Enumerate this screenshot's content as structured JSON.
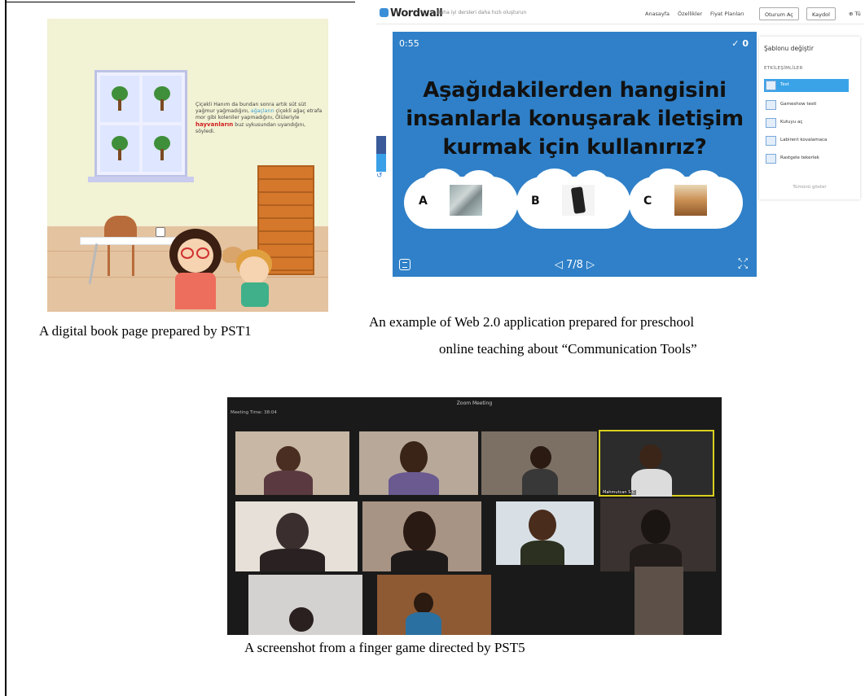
{
  "book": {
    "story_text": "Çiçekli Hanım da bundan sonra artık süt süt yağmur yağmadığını, ağaçların çiçekli ağaç etrafa mor gibi koleniler yapmadığını, Ölüleriyle hayvanların buz uykusundan uyandığını, söyledi.",
    "highlight_1": "ağaçların",
    "highlight_2": "hayvanların"
  },
  "captions": {
    "book": "A digital book page prepared by PST1",
    "wordwall_line1": "An example of Web 2.0 application prepared for preschool",
    "wordwall_line2": "online teaching about “Communication Tools”",
    "zoom": "A screenshot from a finger game directed by PST5"
  },
  "wordwall": {
    "logo": "Wordwall",
    "tagline": "Daha iyi dersleri daha hızlı oluşturun",
    "nav": [
      "Anasayfa",
      "Özellikler",
      "Fiyat Planları"
    ],
    "login": "Oturum Aç",
    "signup": "Kaydol",
    "lang": "Tü",
    "timer": "0:55",
    "score": "✓ 0",
    "question_line1": "Aşağıdakilerden hangisini",
    "question_line2": "insanlarla konuşarak iletişim",
    "question_line3": "kurmak için kullanırız?",
    "options": [
      "A",
      "B",
      "C"
    ],
    "pager": "◁ 7/8 ▷",
    "panel": {
      "title": "Şablonu değiştir",
      "subtitle": "ETKİLEŞİMLİLER",
      "items": [
        "Test",
        "Gameshow testi",
        "Kutuyu aç",
        "Labirent kovalamaca",
        "Rastgele tekerlek"
      ],
      "more": "Tümünü göster"
    }
  },
  "zoom": {
    "title": "Zoom Meeting",
    "meeting_time": "Meeting Time: 38:04",
    "active_name": "Mahmutcan S.C"
  },
  "colors": {
    "wordwall_game_bg": "#2f80c8",
    "panel_selected": "#3aa3e8",
    "book_wall": "#f2f2d4",
    "zoom_bg": "#1a1a1a"
  }
}
